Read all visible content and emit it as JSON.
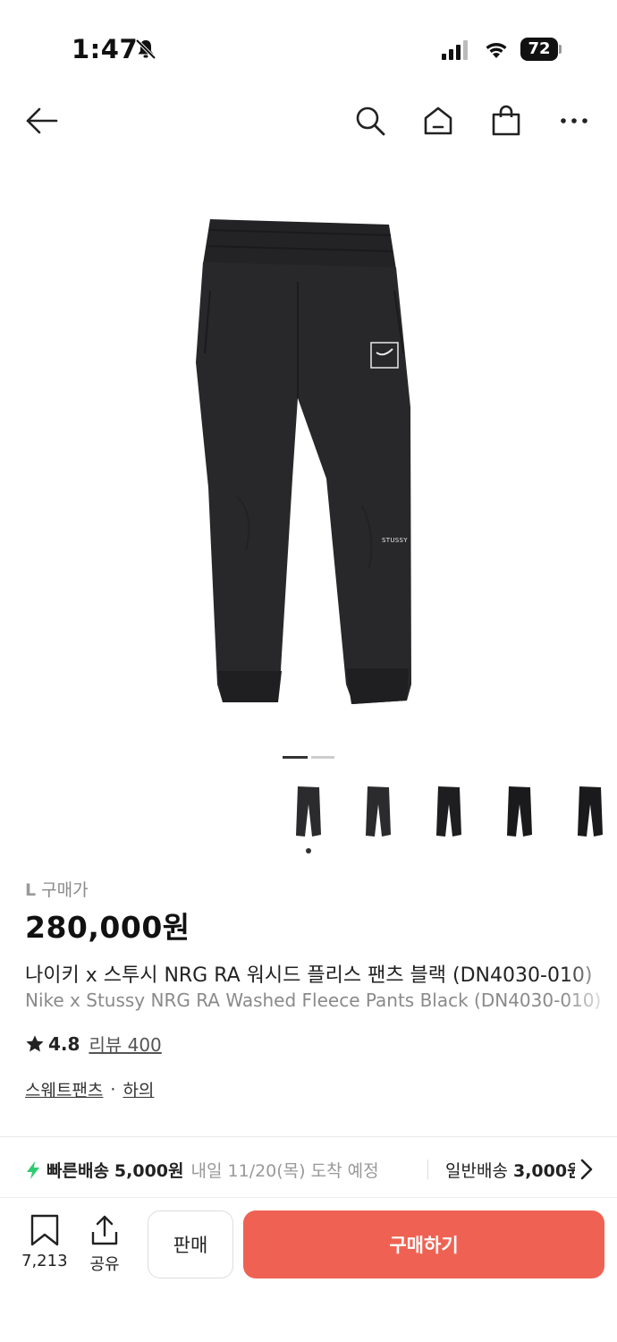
{
  "status_bar": {
    "time": "1:47",
    "battery": "72",
    "icons": [
      "bell-muted-icon",
      "signal-icon",
      "wifi-icon",
      "battery-icon"
    ]
  },
  "nav": {
    "icons": [
      "back-arrow-icon",
      "search-icon",
      "home-icon",
      "shopping-bag-icon",
      "more-icon"
    ]
  },
  "carousel": {
    "thumbnail_count": 5,
    "active_index": 0
  },
  "product": {
    "size_badge": "L",
    "price_label": "구매가",
    "price": "280,000원",
    "title_ko": "나이키 x 스투시 NRG RA 워시드 플리스 팬츠 블랙 (DN4030-010)",
    "title_en": "Nike x Stussy NRG RA Washed Fleece Pants Black (DN4030-010)",
    "rating": "4.8",
    "review_label": "리뷰 400",
    "categories": [
      "스웨트팬츠",
      "하의"
    ],
    "category_separator": "·",
    "logo_text": "STUSSY"
  },
  "shipping": {
    "fast_label": "빠른배송",
    "fast_price": "5,000원",
    "fast_eta": "내일 11/20(목) 도착 예정",
    "normal_label": "일반배송",
    "normal_price": "3,000원"
  },
  "bottom_bar": {
    "bookmark_count": "7,213",
    "share_label": "공유",
    "sell_label": "판매",
    "buy_label": "구매하기"
  },
  "colors": {
    "accent": "#ef6253",
    "bolt": "#2ecc71"
  }
}
